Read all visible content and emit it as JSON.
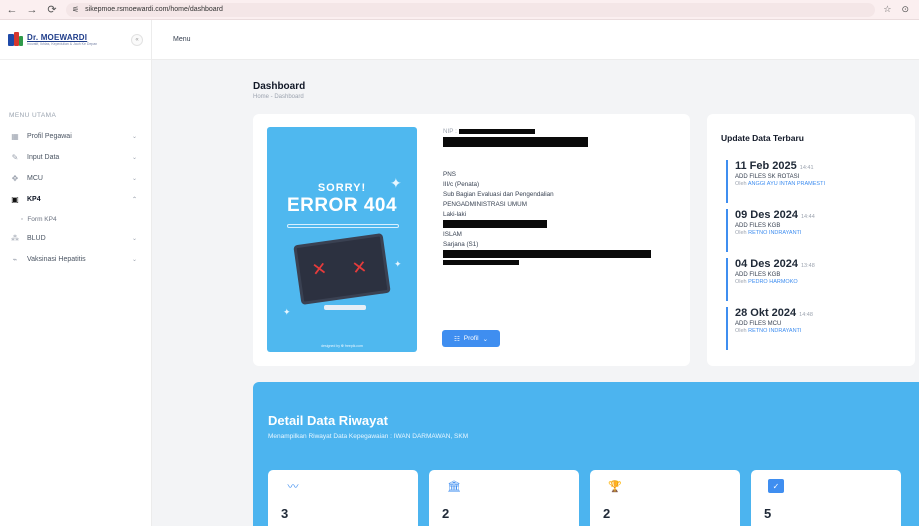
{
  "browser": {
    "back": "←",
    "forward": "→",
    "reload": "⟳",
    "tune_icon": "⚟",
    "url": "sikepmoe.rsmoewardi.com/home/dashboard",
    "star": "☆",
    "profile": "⊙"
  },
  "brand": {
    "name": "Dr. MOEWARDI",
    "tagline": "Inovatif, Ikhlas, Kepedulian & Jauh Ke Depan"
  },
  "sidebar": {
    "collapse": "«",
    "heading": "MENU UTAMA",
    "items": [
      {
        "label": "Profil Pegawai",
        "icon": "▦",
        "chev": "⌄"
      },
      {
        "label": "Input Data",
        "icon": "✎",
        "chev": "⌄"
      },
      {
        "label": "MCU",
        "icon": "✥",
        "chev": "⌄"
      },
      {
        "label": "KP4",
        "icon": "▣",
        "chev": "⌃"
      },
      {
        "label": "BLUD",
        "icon": "⁂",
        "chev": "⌄"
      },
      {
        "label": "Vaksinasi Hepatitis",
        "icon": "⌁",
        "chev": "⌄"
      }
    ],
    "sub_kp4": "Form KP4"
  },
  "topbar": {
    "menu": "Menu"
  },
  "page": {
    "title": "Dashboard",
    "breadcrumb": "Home  -  Dashboard"
  },
  "profile": {
    "poster": {
      "sorry": "SORRY!",
      "error": "ERROR 404",
      "x": "✕",
      "credit": "designed by ❁ freepik.com",
      "sparkle": "✦"
    },
    "nip_label": "NIP :",
    "status": "PNS",
    "rank": "III/c (Penata)",
    "unit1": "Sub Bagian Evaluasi dan Pengendalian",
    "unit2": "PENGADMINISTRASI UMUM",
    "gender": "Laki-laki",
    "religion": "ISLAM",
    "education": "Sarjana (S1)",
    "button": "Profil",
    "button_icon": "☷",
    "button_chev": "⌄"
  },
  "updates": {
    "title": "Update Data Terbaru",
    "by_prefix": "Oleh",
    "items": [
      {
        "date": "11 Feb 2025",
        "time": "14:41",
        "action": "ADD FILES SK ROTASI",
        "name": "ANGGI AYU INTAN PRAMESTI"
      },
      {
        "date": "09 Des 2024",
        "time": "14:44",
        "action": "ADD FILES KGB",
        "name": "RETNO INDRAYANTI"
      },
      {
        "date": "04 Des 2024",
        "time": "13:48",
        "action": "ADD FILES KGB",
        "name": "PEDRO HARMOKO"
      },
      {
        "date": "28 Okt 2024",
        "time": "14:48",
        "action": "ADD FILES MCU",
        "name": "RETNO INDRAYANTI"
      }
    ]
  },
  "riwayat": {
    "title": "Detail Data Riwayat",
    "subtitle": "Menampilkan Riwayat Data Kepegawaian : IWAN DARMAWAN, SKM",
    "stats": [
      {
        "icon": "〰",
        "value": "3"
      },
      {
        "icon": "🏛",
        "value": "2"
      },
      {
        "icon": "🏆",
        "value": "2"
      },
      {
        "icon": "✓",
        "value": "5"
      }
    ]
  },
  "colors": {
    "accent": "#3f8ef0",
    "banner": "#4cb4ef",
    "poster": "#4fb8ef"
  }
}
